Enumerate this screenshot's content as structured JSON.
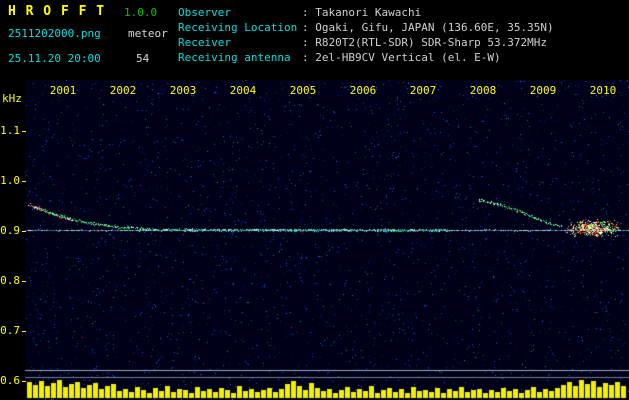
{
  "header": {
    "title": "H R O F F T",
    "version": "1.0.0",
    "filename": "2511202000.png",
    "mode": "meteor",
    "datetime": "25.11.20 20:00",
    "count": "54",
    "station": [
      {
        "label": "Observer",
        "value": ": Takanori Kawachi"
      },
      {
        "label": "Receiving Location",
        "value": ": Ogaki, Gifu, JAPAN (136.60E, 35.35N)"
      },
      {
        "label": "Receiver",
        "value": ": R820T2(RTL-SDR) SDR-Sharp 53.372MHz"
      },
      {
        "label": "Receiving antenna",
        "value": ": 2el-HB9CV Vertical (el. E-W)"
      }
    ]
  },
  "chart_data": {
    "type": "heatmap",
    "title": "HROFFT 10-minute radio meteor echo spectrogram",
    "x_axis": {
      "ticks": [
        "2001",
        "2002",
        "2003",
        "2004",
        "2005",
        "2006",
        "2007",
        "2008",
        "2009",
        "2010"
      ]
    },
    "y_axis": {
      "unit": "kHz",
      "ticks": [
        "1.1",
        "1.0",
        "0.9",
        "0.8",
        "0.7",
        "0.6"
      ],
      "range_khz": [
        0.58,
        1.17
      ]
    },
    "grid": "off",
    "legend": "off",
    "carrier_freq_khz": 0.9,
    "events": [
      {
        "id": "carrier-line",
        "type": "hline",
        "freq_khz": 0.9,
        "color": "#9ad8f0"
      },
      {
        "id": "meteor-trail-a",
        "type": "trace",
        "color": "#e0335a",
        "mix": [
          "#ffffff",
          "#ff9966"
        ],
        "points_min_khz": [
          [
            0.45,
            0.952
          ],
          [
            0.7,
            0.938
          ],
          [
            0.95,
            0.927
          ],
          [
            1.15,
            0.92
          ]
        ]
      },
      {
        "id": "meteor-trail-b",
        "type": "trace",
        "color": "#33dd66",
        "mix": [
          "#bbffcc"
        ],
        "points_min_khz": [
          [
            0.5,
            0.948
          ],
          [
            0.9,
            0.93
          ],
          [
            1.4,
            0.915
          ],
          [
            1.9,
            0.906
          ],
          [
            2.5,
            0.901
          ]
        ]
      },
      {
        "id": "direct-signal",
        "type": "trace",
        "color": "#39c8a0",
        "mix": [
          "#bfeee0"
        ],
        "points_min_khz": [
          [
            2.5,
            0.9
          ],
          [
            7.5,
            0.899
          ]
        ]
      },
      {
        "id": "meteor-trail-c",
        "type": "trace",
        "color": "#33dd66",
        "mix": [
          "#ffffff"
        ],
        "points_min_khz": [
          [
            7.95,
            0.96
          ],
          [
            8.35,
            0.949
          ],
          [
            8.75,
            0.931
          ],
          [
            9.1,
            0.914
          ],
          [
            9.35,
            0.906
          ]
        ]
      },
      {
        "id": "meteor-burst",
        "type": "cluster",
        "count": 520,
        "center_min_khz": [
          9.85,
          0.903
        ],
        "spread_min_khz": [
          0.45,
          0.018
        ],
        "colors": [
          "#ff3344",
          "#33ee55",
          "#ffffff",
          "#ffcc33"
        ]
      }
    ],
    "reference_lines_khz": [
      0.62,
      0.606
    ],
    "signal_level_bars": [
      16,
      13,
      17,
      12,
      15,
      18,
      11,
      14,
      16,
      10,
      13,
      15,
      9,
      12,
      14,
      7,
      9,
      6,
      11,
      8,
      5,
      10,
      7,
      12,
      6,
      9,
      8,
      5,
      11,
      7,
      9,
      6,
      10,
      8,
      5,
      12,
      7,
      9,
      6,
      8,
      10,
      6,
      9,
      14,
      17,
      12,
      8,
      15,
      10,
      7,
      9,
      5,
      8,
      11,
      6,
      9,
      7,
      12,
      5,
      8,
      10,
      6,
      9,
      5,
      11,
      7,
      8,
      6,
      10,
      5,
      9,
      7,
      11,
      6,
      8,
      9,
      5,
      8,
      6,
      10,
      7,
      9,
      5,
      8,
      11,
      6,
      9,
      7,
      10,
      13,
      16,
      12,
      18,
      14,
      17,
      11,
      15,
      13,
      16,
      12
    ]
  },
  "colors": {
    "background": "#000000",
    "noise_base": "#000018",
    "axis_text": "#ffff00",
    "label_text": "#00e0e0",
    "value_text": "#d0d0d0",
    "version_text": "#00c800",
    "signal_bars": "#f0f000"
  }
}
